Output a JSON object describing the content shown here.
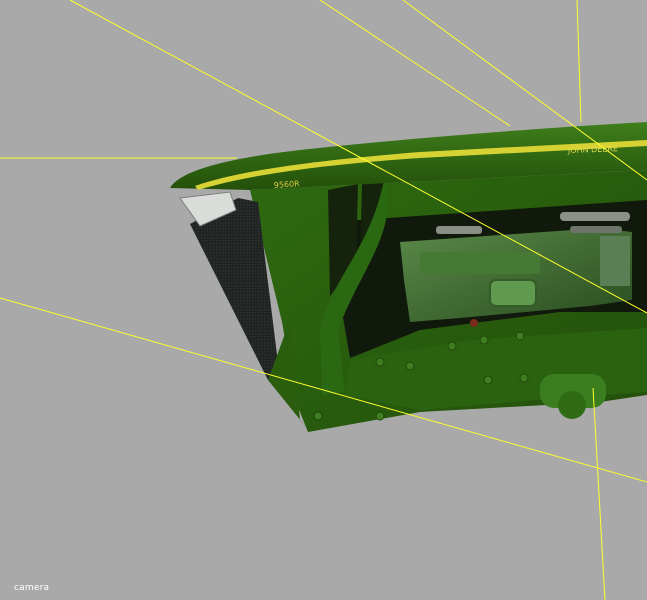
{
  "viewport": {
    "camera_label": "camera",
    "background": "#a9a9a9",
    "guide_line_color": "#ffff2a"
  },
  "model": {
    "brand_decal": "JOHN DEERE",
    "model_decal": "9560R",
    "body_color": "#2f6a10",
    "stripe_color": "#d7d233"
  }
}
